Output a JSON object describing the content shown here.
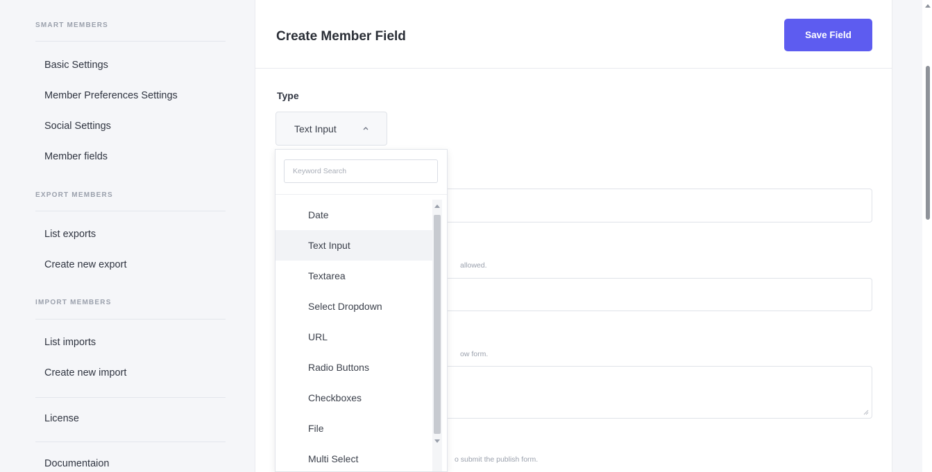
{
  "sidebar": {
    "sections": [
      {
        "heading": "SMART MEMBERS",
        "items": [
          "Basic Settings",
          "Member Preferences Settings",
          "Social Settings",
          "Member fields"
        ]
      },
      {
        "heading": "EXPORT MEMBERS",
        "items": [
          "List exports",
          "Create new export"
        ]
      },
      {
        "heading": "IMPORT MEMBERS",
        "items": [
          "List imports",
          "Create new import"
        ]
      }
    ],
    "license": "License",
    "documentation": "Documentaion"
  },
  "header": {
    "title": "Create Member Field",
    "save_label": "Save Field"
  },
  "form": {
    "type_label": "Type",
    "type_value": "Text Input",
    "hint_2": "allowed.",
    "hint_3": "ow form.",
    "hint_4": "o submit the publish form."
  },
  "dropdown": {
    "search_placeholder": "Keyword Search",
    "options": [
      "Date",
      "Text Input",
      "Textarea",
      "Select Dropdown",
      "URL",
      "Radio Buttons",
      "Checkboxes",
      "File",
      "Multi Select"
    ],
    "selected": "Text Input"
  },
  "colors": {
    "accent": "#5d5cf0",
    "page_bg": "#f5f6f9"
  }
}
